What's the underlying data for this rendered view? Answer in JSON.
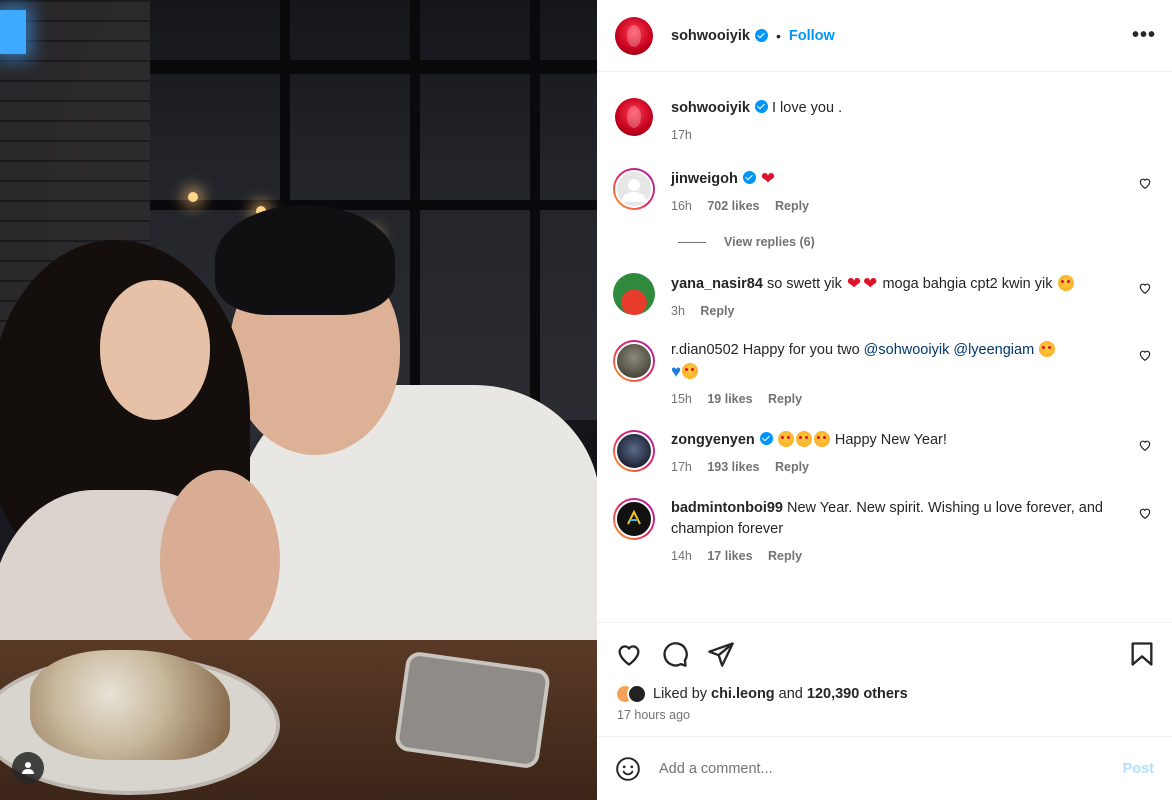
{
  "post": {
    "author": "sohwooiyik",
    "follow_label": "Follow",
    "dot": "•",
    "more": "•••"
  },
  "caption": {
    "user": "sohwooiyik",
    "text": "I love you .",
    "time": "17h"
  },
  "comments": [
    {
      "user": "jinweigoh",
      "verified": true,
      "text": "",
      "time": "16h",
      "likes": "702 likes",
      "reply": "Reply",
      "view_replies": "View replies (6)"
    },
    {
      "user": "yana_nasir84",
      "verified": false,
      "text_a": "so swett yik",
      "text_b": "moga bahgia cpt2 kwin yik",
      "time": "3h",
      "reply": "Reply"
    },
    {
      "user": "r.dian0502",
      "verified": false,
      "text_a": "Happy for you two",
      "mention_1": "@sohwooiyik",
      "mention_2": "@lyeengiam",
      "time": "15h",
      "likes": "19 likes",
      "reply": "Reply"
    },
    {
      "user": "zongyenyen",
      "verified": true,
      "text": "Happy New Year!",
      "time": "17h",
      "likes": "193 likes",
      "reply": "Reply"
    },
    {
      "user": "badmintonboi99",
      "verified": false,
      "text": "New Year. New spirit. Wishing u love forever, and champion forever",
      "time": "14h",
      "likes": "17 likes",
      "reply": "Reply"
    }
  ],
  "likes": {
    "prefix": "Liked by",
    "user": "chi.leong",
    "middle": "and",
    "count": "120,390 others"
  },
  "posted_ago": "17 hours ago",
  "add_comment": {
    "placeholder": "Add a comment...",
    "post_label": "Post"
  },
  "icons": [
    "heart-icon",
    "comment-icon",
    "share-icon",
    "bookmark-icon",
    "emoji-icon",
    "user-tag-icon"
  ],
  "colors": {
    "accent": "#0095f6",
    "heart": "#e0112b",
    "muted": "#737373"
  }
}
